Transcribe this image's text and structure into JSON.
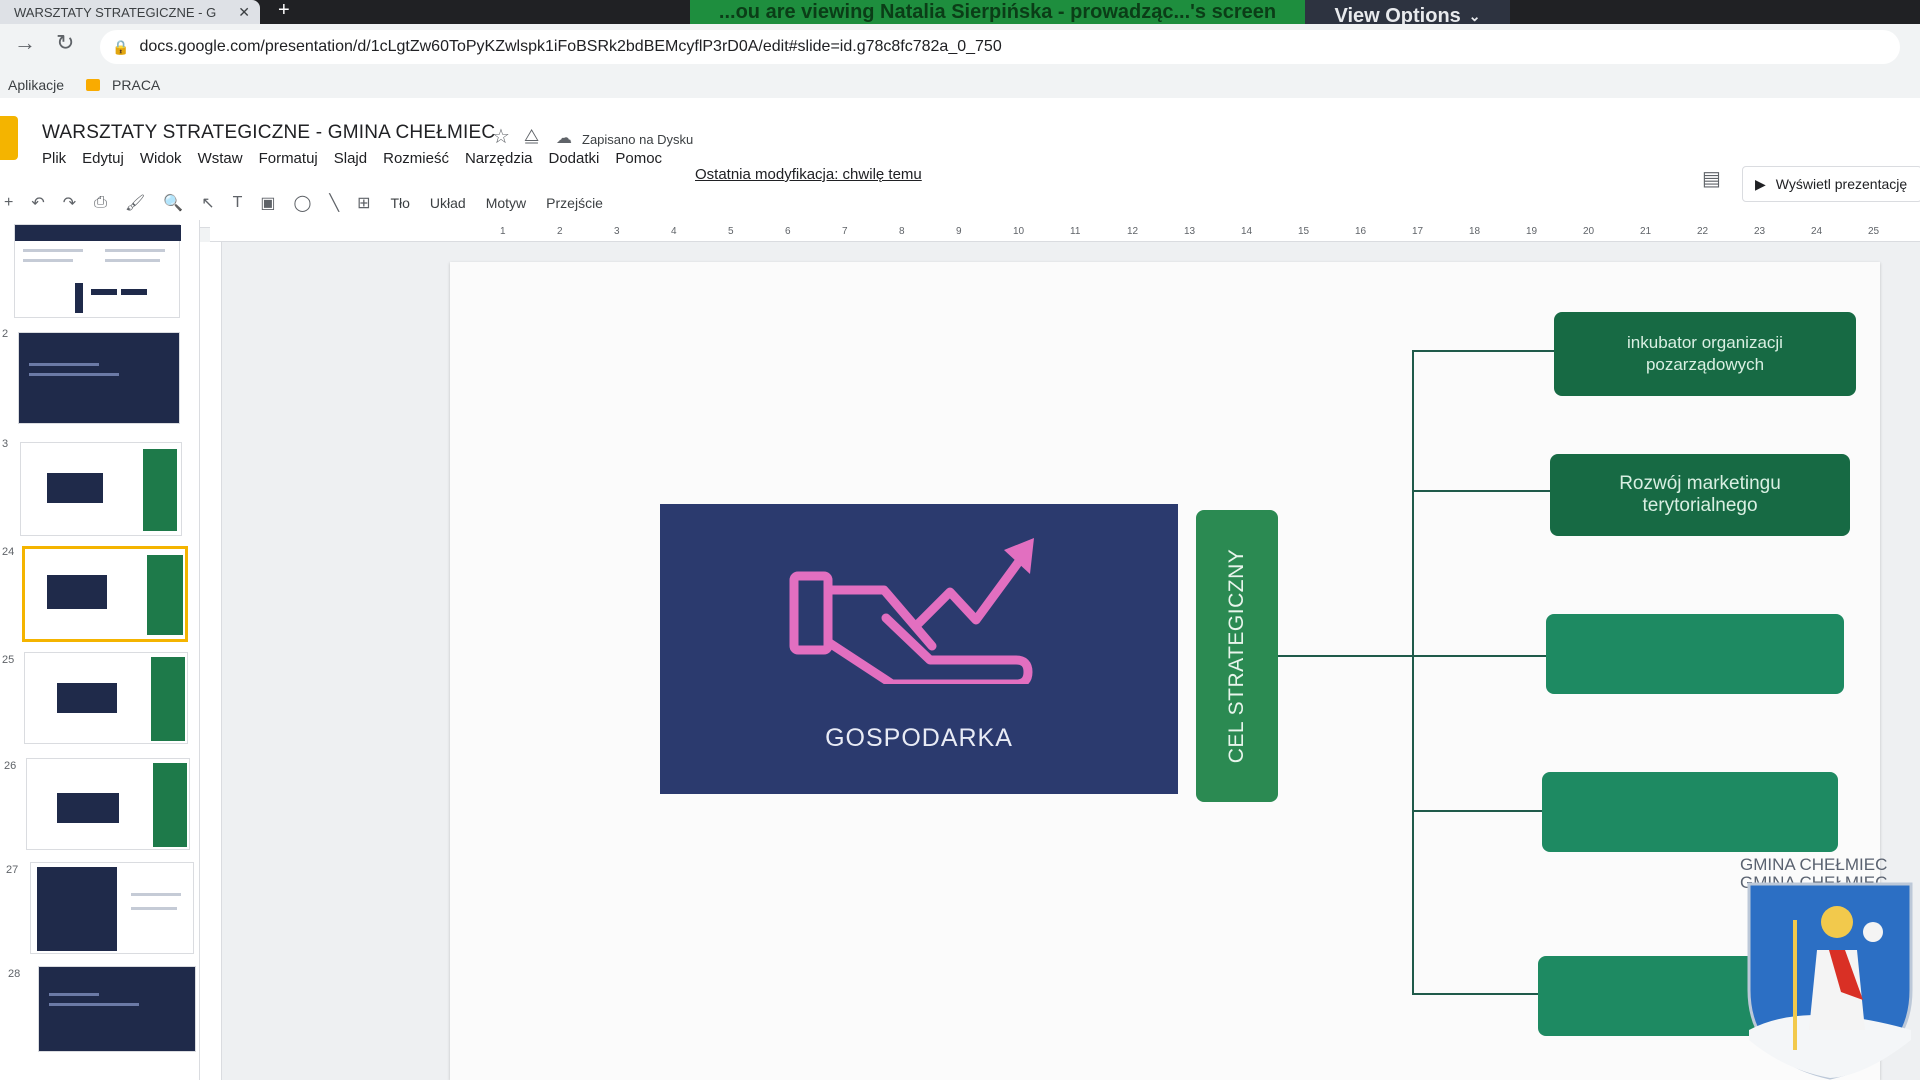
{
  "browser": {
    "tab_title": "WARSZTATY STRATEGICZNE - G",
    "share_banner": "...ou are viewing Natalia Sierpińska - prowadząc...'s screen",
    "view_options": "View Options",
    "url": "docs.google.com/presentation/d/1cLgtZw60ToPyKZwlspk1iFoBSRk2bdBEMcyflP3rD0A/edit#slide=id.g78c8fc782a_0_750",
    "bookmarks": [
      "Aplikacje",
      "PRACA"
    ]
  },
  "document": {
    "title": "WARSZTATY STRATEGICZNE - GMINA CHEŁMIEC",
    "saved_status": "Zapisano na Dysku",
    "menu": [
      "Plik",
      "Edytuj",
      "Widok",
      "Wstaw",
      "Formatuj",
      "Slajd",
      "Rozmieść",
      "Narzędzia",
      "Dodatki",
      "Pomoc"
    ],
    "last_modified": "Ostatnia modyfikacja: chwilę temu",
    "present_label": "Wyświetl prezentację"
  },
  "toolbar": {
    "background": "Tło",
    "layout": "Układ",
    "theme": "Motyw",
    "transition": "Przejście"
  },
  "filmstrip": {
    "numbers": [
      "2",
      "3",
      "24",
      "25",
      "26",
      "27",
      "28"
    ]
  },
  "ruler": {
    "ticks": [
      "1",
      "2",
      "3",
      "4",
      "5",
      "6",
      "7",
      "8",
      "9",
      "10",
      "11",
      "12",
      "13",
      "14",
      "15",
      "16",
      "17",
      "18",
      "19",
      "20",
      "21",
      "22",
      "23",
      "24",
      "25"
    ]
  },
  "slide": {
    "main_label": "GOSPODARKA",
    "strategic_goal": "CEL STRATEGICZNY",
    "goals": [
      "inkubator organizacji pozarządowych",
      "Rozwój marketingu terytorialnego",
      "",
      "",
      ""
    ],
    "municipality": [
      "GMINA CHEŁMIEC",
      "GMINA CHEŁMIEC"
    ],
    "colors": {
      "navy": "#2b3a6e",
      "green": "#2b8a52",
      "dark_green": "#176a44",
      "pink_icon": "#e26fc0"
    }
  }
}
